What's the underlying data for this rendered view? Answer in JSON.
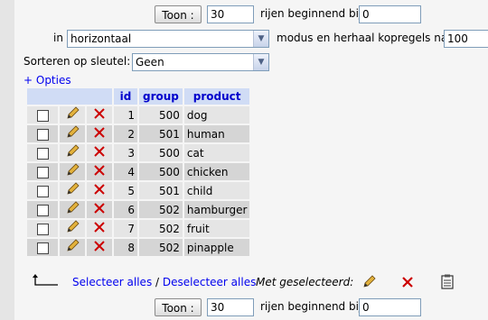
{
  "nav_top": {
    "show_button": "Toon :",
    "rows_value": "30",
    "rows_label": "rijen beginnend bij",
    "start_value": "0",
    "in_label": "in",
    "mode_value": "horizontaal",
    "repeat_label": "modus en herhaal kopregels na",
    "repeat_value": "100"
  },
  "sort": {
    "label": "Sorteren op sleutel:",
    "value": "Geen"
  },
  "options_link": "+ Opties",
  "table": {
    "headers": [
      "id",
      "group",
      "product"
    ],
    "rows": [
      {
        "id": "1",
        "group": "500",
        "product": "dog"
      },
      {
        "id": "2",
        "group": "501",
        "product": "human"
      },
      {
        "id": "3",
        "group": "500",
        "product": "cat"
      },
      {
        "id": "4",
        "group": "500",
        "product": "chicken"
      },
      {
        "id": "5",
        "group": "501",
        "product": "child"
      },
      {
        "id": "6",
        "group": "502",
        "product": "hamburger"
      },
      {
        "id": "7",
        "group": "502",
        "product": "fruit"
      },
      {
        "id": "8",
        "group": "502",
        "product": "pinapple"
      }
    ]
  },
  "bulk": {
    "select_all": "Selecteer alles",
    "separator": " / ",
    "deselect_all": "Deselecteer alles",
    "with_selected": "Met geselecteerd:"
  },
  "nav_bottom": {
    "show_button": "Toon :",
    "rows_value": "30",
    "rows_label": "rijen beginnend bij",
    "start_value": "0"
  }
}
